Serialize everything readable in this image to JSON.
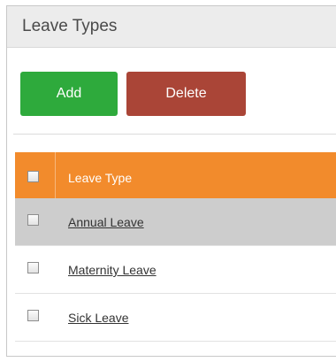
{
  "panel": {
    "title": "Leave Types"
  },
  "toolbar": {
    "add_label": "Add",
    "delete_label": "Delete",
    "add_color": "#2eaa3c",
    "delete_color": "#aa4537"
  },
  "table": {
    "header_color": "#f28b2c",
    "columns": [
      "Leave Type"
    ],
    "rows": [
      {
        "leave_type": "Annual Leave"
      },
      {
        "leave_type": "Maternity Leave"
      },
      {
        "leave_type": "Sick Leave"
      }
    ]
  }
}
